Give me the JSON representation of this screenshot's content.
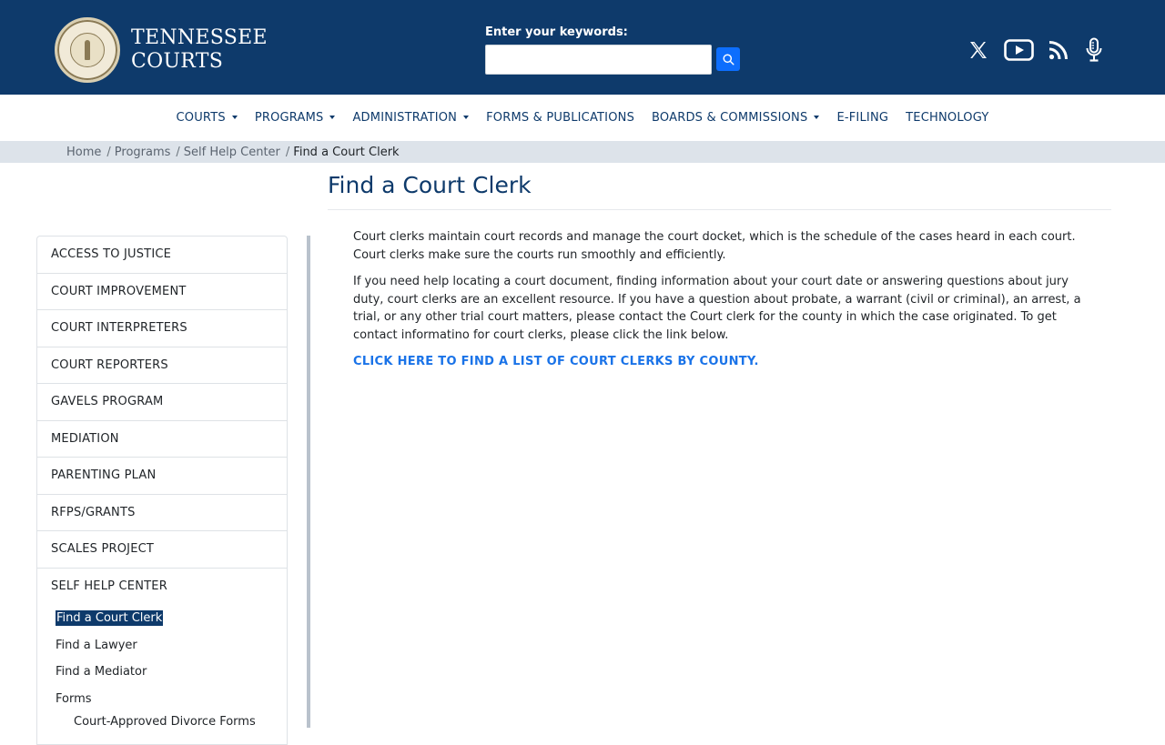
{
  "header": {
    "brand_line1": "TENNESSEE",
    "brand_line2": "COURTS",
    "search": {
      "label": "Enter your keywords:",
      "value": "",
      "placeholder": ""
    },
    "social_icons": [
      "x-icon",
      "youtube-icon",
      "rss-icon",
      "podcast-mic-icon"
    ],
    "colors": {
      "header_bg": "#0e3a6b",
      "search_button": "#0d6efd",
      "link": "#1a73e8"
    }
  },
  "nav": {
    "items": [
      {
        "label": "COURTS",
        "dropdown": true
      },
      {
        "label": "PROGRAMS",
        "dropdown": true
      },
      {
        "label": "ADMINISTRATION",
        "dropdown": true
      },
      {
        "label": "FORMS & PUBLICATIONS",
        "dropdown": false
      },
      {
        "label": "BOARDS & COMMISSIONS",
        "dropdown": true
      },
      {
        "label": "E-FILING",
        "dropdown": false
      },
      {
        "label": "TECHNOLOGY",
        "dropdown": false
      }
    ]
  },
  "breadcrumb": {
    "items": [
      "Home",
      "Programs",
      "Self Help Center"
    ],
    "current": "Find a Court Clerk"
  },
  "sidebar": {
    "items": [
      "ACCESS TO JUSTICE",
      "COURT IMPROVEMENT",
      "COURT INTERPRETERS",
      "COURT REPORTERS",
      "GAVELS PROGRAM",
      "MEDIATION",
      "PARENTING PLAN",
      "RFPS/GRANTS",
      "SCALES PROJECT",
      "SELF HELP CENTER"
    ],
    "sub_items": [
      "Find a Court Clerk",
      "Find a Lawyer",
      "Find a Mediator",
      "Forms"
    ],
    "active_sub_item": "Find a Court Clerk",
    "sub_sub_items": [
      "Court-Approved Divorce Forms"
    ]
  },
  "main": {
    "title": "Find a Court Clerk",
    "paragraph1": "Court clerks maintain court records and manage the court docket, which is the schedule of the cases heard in each court. Court clerks make sure the courts run smoothly and efficiently.",
    "paragraph2": "If you need help locating a court document, finding information about your court date or answering questions about jury duty, court clerks are an excellent resource. If you have a question about probate, a warrant (civil or criminal), an arrest, a trial, or any other trial court matters, please contact the Court clerk for the county in which the case originated. To get contact informatino for court clerks, please click the link below.",
    "cta_link": "CLICK HERE TO FIND A LIST OF COURT CLERKS BY COUNTY."
  }
}
